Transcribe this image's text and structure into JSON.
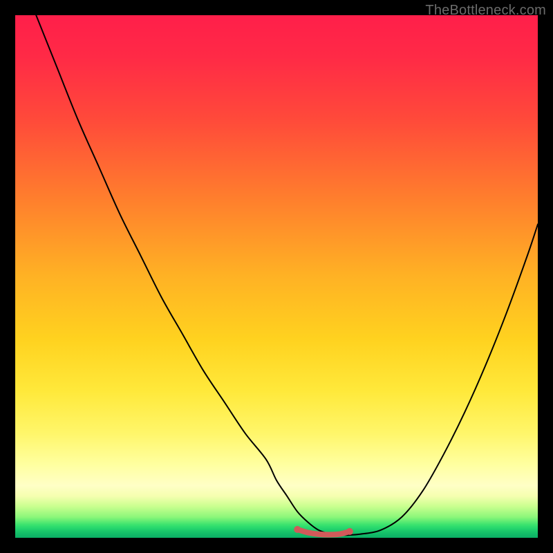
{
  "watermark": {
    "text": "TheBottleneck.com"
  },
  "colors": {
    "frame": "#000000",
    "watermark": "#6b6b6b",
    "curve": "#000000",
    "highlight": "#d15a5a"
  },
  "chart_data": {
    "type": "line",
    "title": "",
    "xlabel": "",
    "ylabel": "",
    "xlim": [
      0,
      100
    ],
    "ylim": [
      0,
      100
    ],
    "grid": false,
    "legend": false,
    "series": [
      {
        "name": "bottleneck-curve",
        "x": [
          4,
          8,
          12,
          16,
          20,
          24,
          28,
          32,
          36,
          40,
          44,
          48,
          50,
          52,
          54,
          56,
          58,
          60,
          62,
          66,
          70,
          74,
          78,
          82,
          86,
          90,
          94,
          98,
          100
        ],
        "y": [
          100,
          90,
          80,
          71,
          62,
          54,
          46,
          39,
          32,
          26,
          20,
          15,
          11,
          8,
          5,
          3,
          1.5,
          0.8,
          0.5,
          0.7,
          1.5,
          4,
          9,
          16,
          24,
          33,
          43,
          54,
          60
        ]
      },
      {
        "name": "optimal-flat-region",
        "x": [
          54,
          56,
          58,
          60,
          62,
          64
        ],
        "y": [
          1.6,
          1.0,
          0.7,
          0.6,
          0.7,
          1.2
        ]
      }
    ],
    "annotations": []
  }
}
